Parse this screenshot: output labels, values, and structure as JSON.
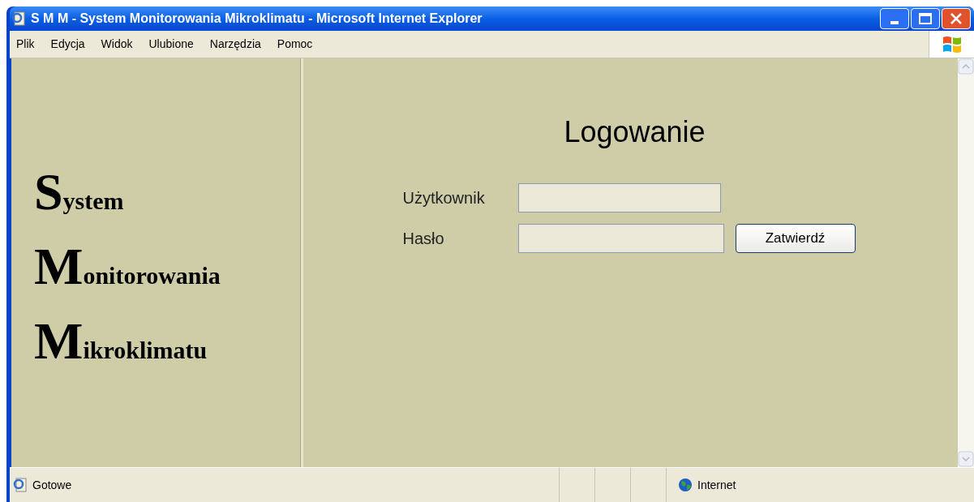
{
  "window": {
    "title": "S M M - System Monitorowania Mikroklimatu - Microsoft Internet Explorer"
  },
  "menu": [
    "Plik",
    "Edycja",
    "Widok",
    "Ulubione",
    "Narzędzia",
    "Pomoc"
  ],
  "logo": [
    "System",
    "Monitorowania",
    "Mikroklimatu"
  ],
  "login": {
    "title": "Logowanie",
    "fields": [
      {
        "label": "Użytkownik",
        "kind": "text"
      },
      {
        "label": "Hasło",
        "kind": "password"
      }
    ],
    "submit": "Zatwierdź"
  },
  "status_bar": {
    "text": "Gotowe",
    "zone": "Internet"
  }
}
